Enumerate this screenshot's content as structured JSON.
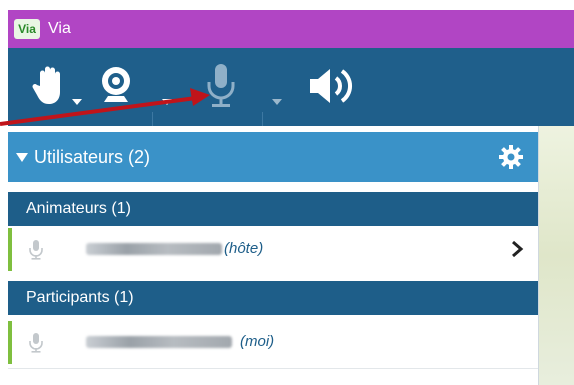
{
  "app": {
    "logo_text": "Via",
    "title": "Via"
  },
  "toolbar": {
    "items": [
      "raise-hand",
      "webcam",
      "microphone",
      "speaker"
    ],
    "colors": {
      "background": "#1f5f8b",
      "icon": "#ffffff",
      "mic_disabled": "#8fb0c8"
    }
  },
  "users_panel": {
    "header": "Utilisateurs (2)",
    "sections": [
      {
        "title": "Animateurs (1)",
        "users": [
          {
            "role": "(hôte)",
            "has_chevron": true
          }
        ]
      },
      {
        "title": "Participants (1)",
        "users": [
          {
            "role": "(moi)",
            "has_chevron": false
          }
        ]
      }
    ]
  },
  "annotation": {
    "arrow_color": "#c0141a",
    "points_to": "microphone"
  }
}
